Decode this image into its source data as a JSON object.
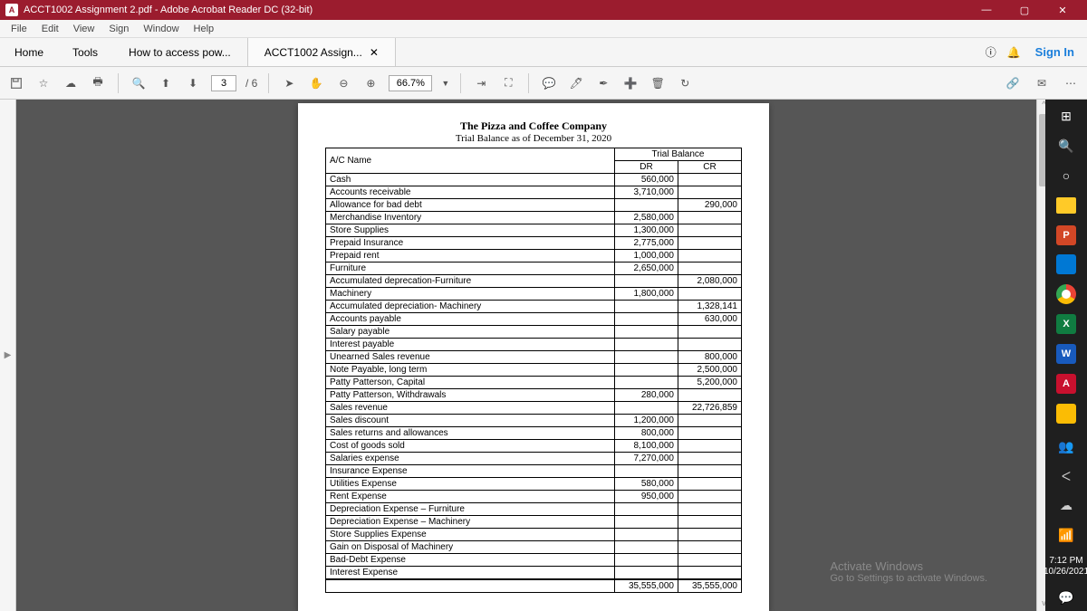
{
  "title": "ACCT1002 Assignment 2.pdf - Adobe Acrobat Reader DC (32-bit)",
  "menu": [
    "File",
    "Edit",
    "View",
    "Sign",
    "Window",
    "Help"
  ],
  "nav": {
    "home": "Home",
    "tools": "Tools",
    "tab1": "How to access pow...",
    "tab2": "ACCT1002 Assign...",
    "signin": "Sign In"
  },
  "toolbar": {
    "page": "3",
    "pages": "/ 6",
    "zoom": "66.7%"
  },
  "doc": {
    "title": "The Pizza and Coffee Company",
    "subtitle": "Trial Balance as of December 31, 2020",
    "h_ac": "A/C Name",
    "h_tb": "Trial Balance",
    "h_dr": "DR",
    "h_cr": "CR",
    "rows": [
      {
        "n": "Cash",
        "dr": "560,000",
        "cr": ""
      },
      {
        "n": "Accounts receivable",
        "dr": "3,710,000",
        "cr": ""
      },
      {
        "n": "Allowance for bad debt",
        "dr": "",
        "cr": "290,000"
      },
      {
        "n": "Merchandise Inventory",
        "dr": "2,580,000",
        "cr": ""
      },
      {
        "n": "Store Supplies",
        "dr": "1,300,000",
        "cr": ""
      },
      {
        "n": "Prepaid Insurance",
        "dr": "2,775,000",
        "cr": ""
      },
      {
        "n": "Prepaid rent",
        "dr": "1,000,000",
        "cr": ""
      },
      {
        "n": "Furniture",
        "dr": "2,650,000",
        "cr": ""
      },
      {
        "n": "Accumulated deprecation-Furniture",
        "dr": "",
        "cr": "2,080,000"
      },
      {
        "n": "Machinery",
        "dr": "1,800,000",
        "cr": ""
      },
      {
        "n": "Accumulated depreciation- Machinery",
        "dr": "",
        "cr": "1,328,141"
      },
      {
        "n": "Accounts payable",
        "dr": "",
        "cr": "630,000"
      },
      {
        "n": "Salary payable",
        "dr": "",
        "cr": ""
      },
      {
        "n": "Interest payable",
        "dr": "",
        "cr": ""
      },
      {
        "n": "Unearned Sales revenue",
        "dr": "",
        "cr": "800,000"
      },
      {
        "n": "Note Payable, long term",
        "dr": "",
        "cr": "2,500,000"
      },
      {
        "n": "Patty Patterson, Capital",
        "dr": "",
        "cr": "5,200,000"
      },
      {
        "n": "Patty Patterson, Withdrawals",
        "dr": "280,000",
        "cr": ""
      },
      {
        "n": "Sales revenue",
        "dr": "",
        "cr": "22,726,859"
      },
      {
        "n": "Sales discount",
        "dr": "1,200,000",
        "cr": ""
      },
      {
        "n": "Sales returns and allowances",
        "dr": "800,000",
        "cr": ""
      },
      {
        "n": "Cost of goods sold",
        "dr": "8,100,000",
        "cr": ""
      },
      {
        "n": "Salaries expense",
        "dr": "7,270,000",
        "cr": ""
      },
      {
        "n": "Insurance Expense",
        "dr": "",
        "cr": ""
      },
      {
        "n": "Utilities Expense",
        "dr": "580,000",
        "cr": ""
      },
      {
        "n": "Rent Expense",
        "dr": "950,000",
        "cr": ""
      },
      {
        "n": "Depreciation Expense – Furniture",
        "dr": "",
        "cr": ""
      },
      {
        "n": "Depreciation Expense – Machinery",
        "dr": "",
        "cr": ""
      },
      {
        "n": "Store Supplies Expense",
        "dr": "",
        "cr": ""
      },
      {
        "n": "Gain on Disposal of Machinery",
        "dr": "",
        "cr": ""
      },
      {
        "n": "Bad-Debt Expense",
        "dr": "",
        "cr": ""
      },
      {
        "n": "Interest Expense",
        "dr": "",
        "cr": ""
      }
    ],
    "tot_dr": "35,555,000",
    "tot_cr": "35,555,000"
  },
  "watermark": {
    "l1": "Activate Windows",
    "l2": "Go to Settings to activate Windows."
  },
  "clock": {
    "time": "7:12 PM",
    "date": "10/26/2021"
  }
}
